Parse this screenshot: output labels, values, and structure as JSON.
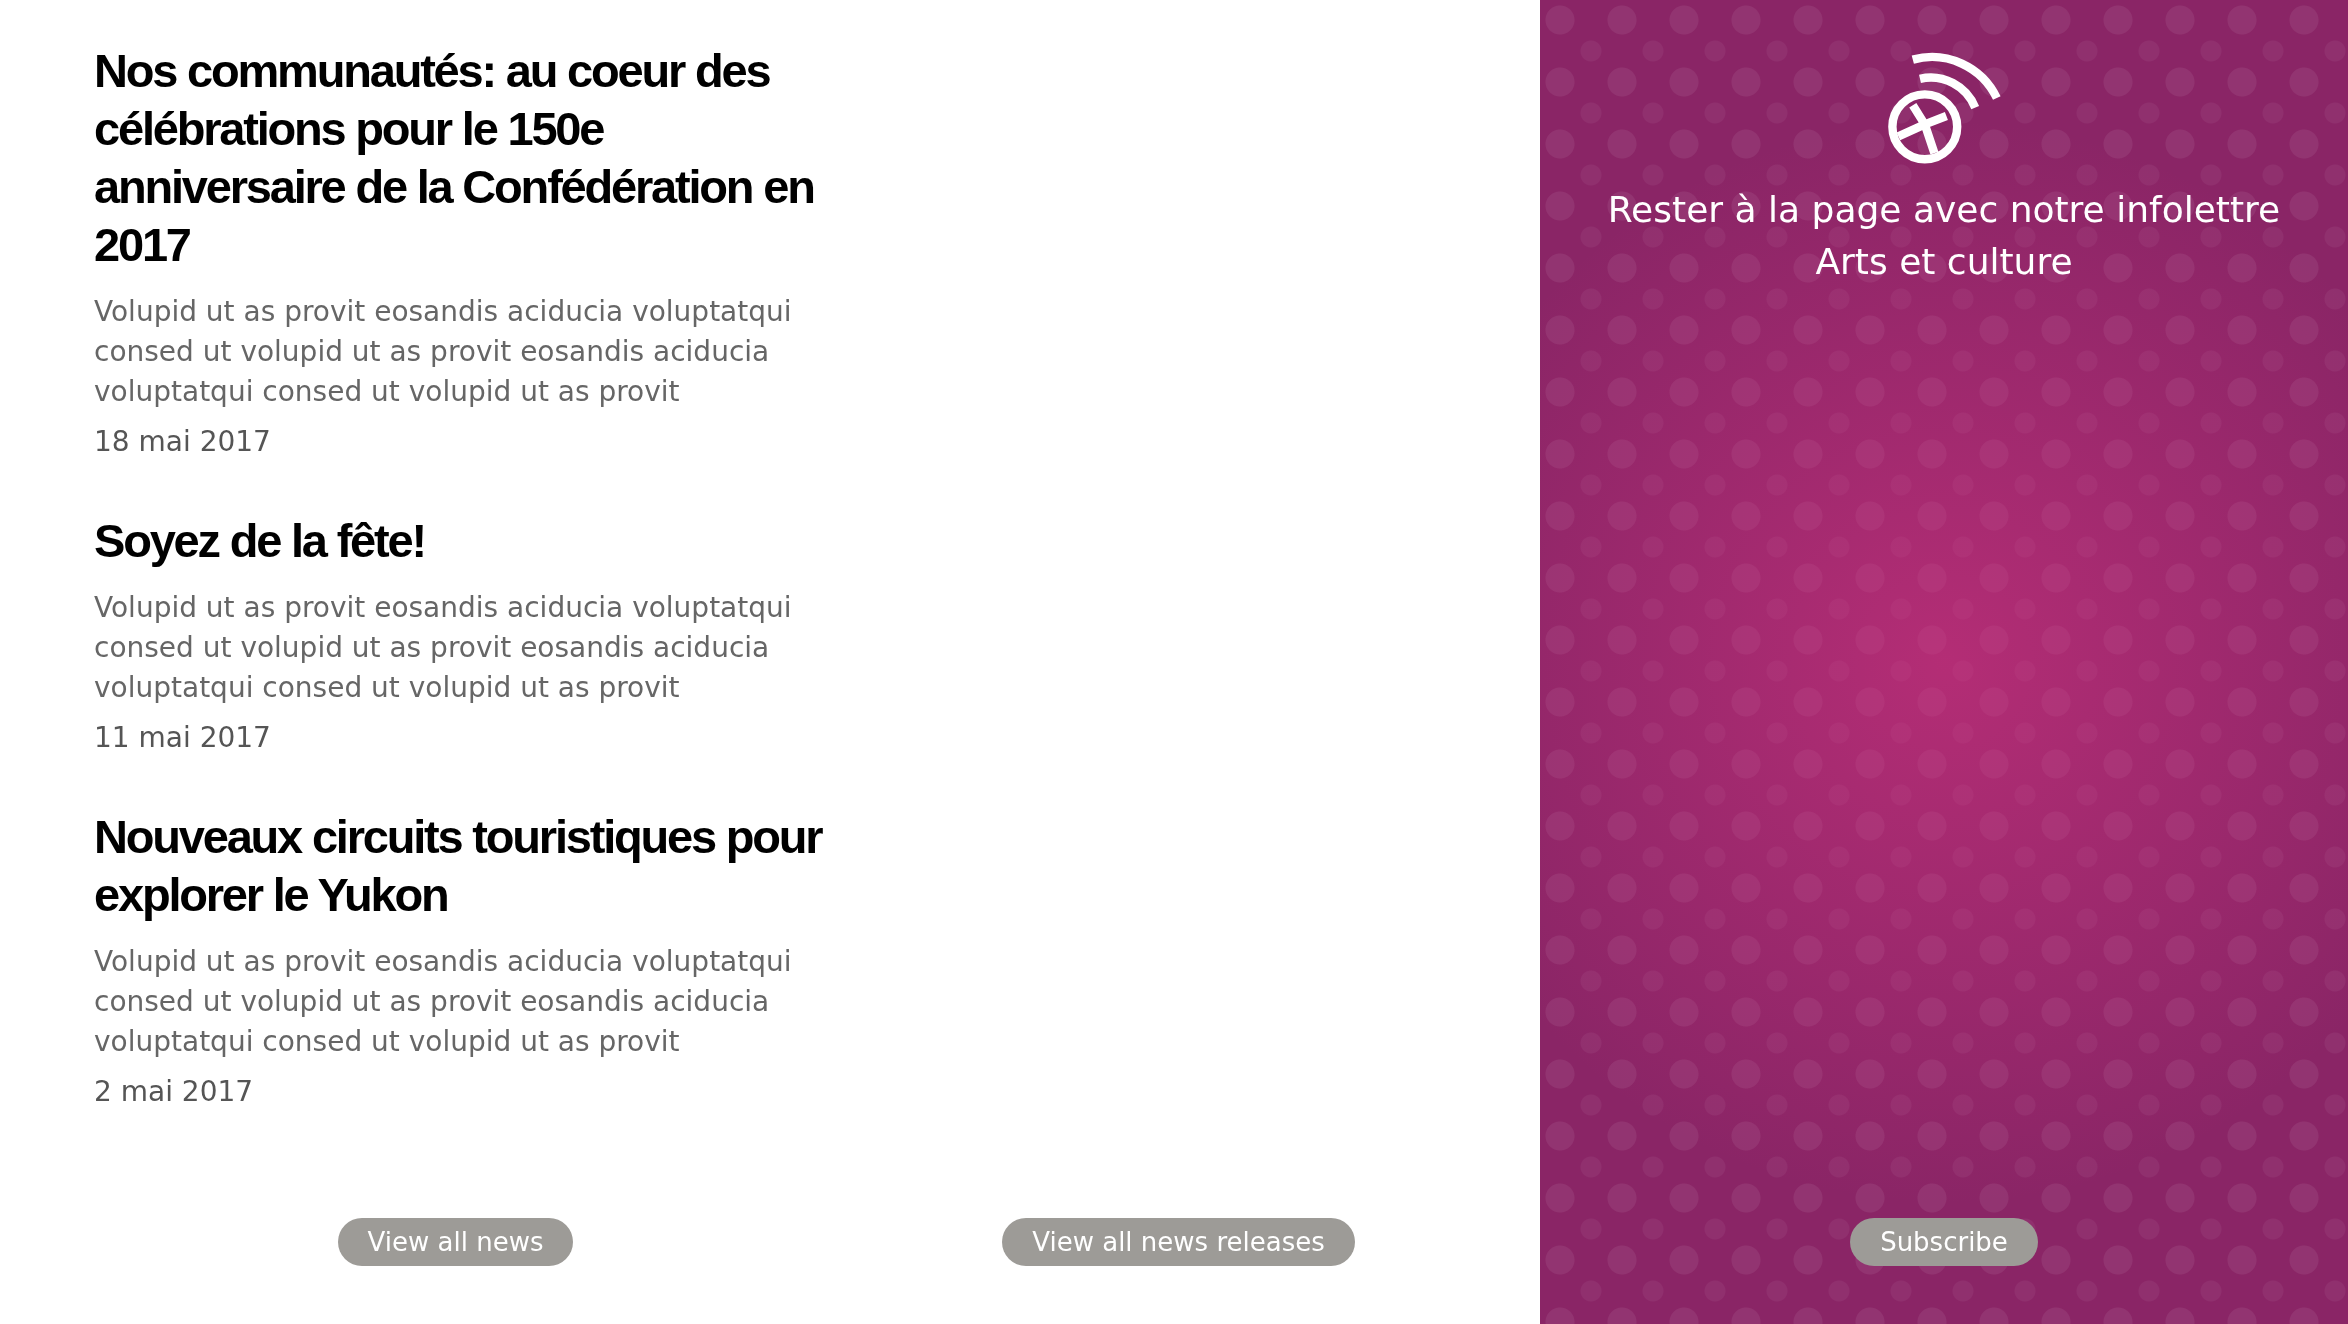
{
  "articles": [
    {
      "title": "Nos communautés: au coeur des célébrations pour le 150e anniversaire de la Confédération en 2017",
      "summary": "Volupid ut as provit eosandis aciducia voluptatqui consed ut volupid ut as provit eosandis aciducia voluptatqui consed ut volupid ut as provit",
      "date": "18 mai 2017"
    },
    {
      "title": "Soyez de la fête!",
      "summary": "Volupid ut as provit eosandis aciducia voluptatqui consed ut volupid ut as provit eosandis aciducia voluptatqui consed ut volupid ut as provit",
      "date": "11 mai 2017"
    },
    {
      "title": "Nouveaux circuits touristiques pour explorer le Yukon",
      "summary": "Volupid ut as provit eosandis aciducia voluptatqui consed ut volupid ut as provit eosandis aciducia voluptatqui consed ut volupid ut as provit",
      "date": "2 mai 2017"
    }
  ],
  "buttons": [
    "View all news",
    "View all news releases"
  ],
  "newsletter": {
    "text": "Rester à la page avec notre infolettre Arts et culture",
    "button": "Subscribe"
  }
}
